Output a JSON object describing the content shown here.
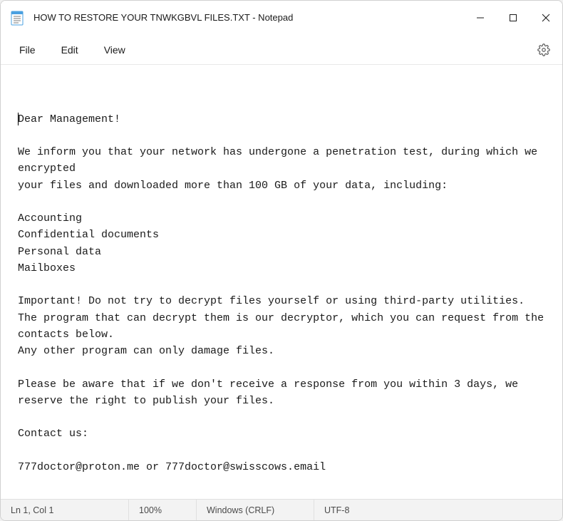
{
  "titlebar": {
    "title": "HOW TO RESTORE YOUR TNWKGBVL FILES.TXT - Notepad"
  },
  "menu": {
    "file": "File",
    "edit": "Edit",
    "view": "View"
  },
  "document": {
    "text": "Dear Management!\n\nWe inform you that your network has undergone a penetration test, during which we encrypted\nyour files and downloaded more than 100 GB of your data, including:\n\nAccounting\nConfidential documents\nPersonal data\nMailboxes\n\nImportant! Do not try to decrypt files yourself or using third-party utilities.\nThe program that can decrypt them is our decryptor, which you can request from the contacts below.\nAny other program can only damage files.\n\nPlease be aware that if we don't receive a response from you within 3 days, we reserve the right to publish your files.\n\nContact us:\n\n777doctor@proton.me or 777doctor@swisscows.email"
  },
  "status": {
    "position": "Ln 1, Col 1",
    "zoom": "100%",
    "eol": "Windows (CRLF)",
    "encoding": "UTF-8"
  }
}
